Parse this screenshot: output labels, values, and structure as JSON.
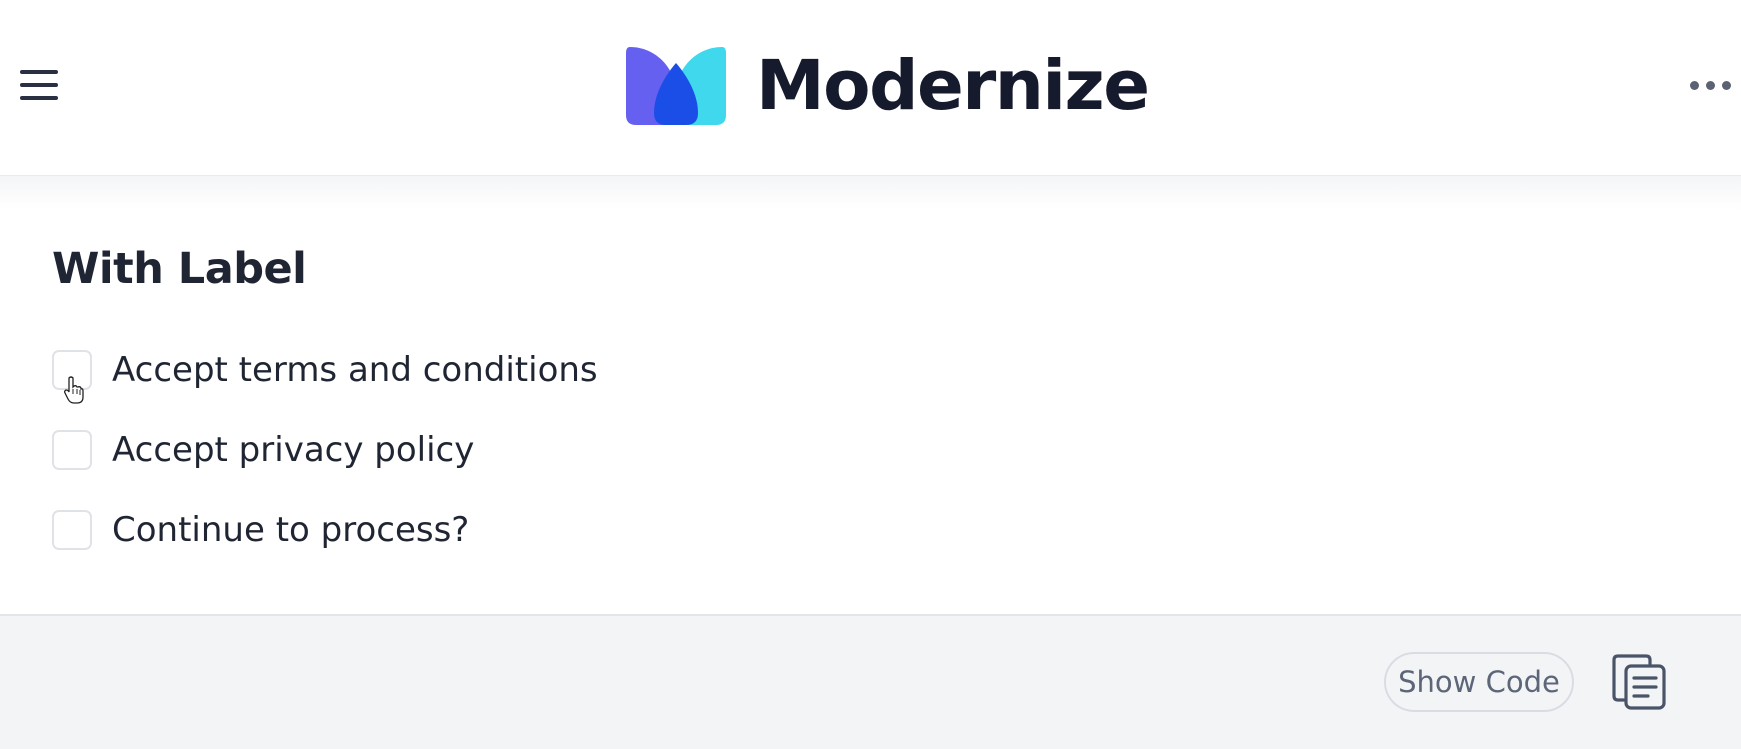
{
  "header": {
    "menu_icon": "hamburger-menu-icon",
    "brand_name": "Modernize",
    "brand_logo_icon": "modernize-logo-icon",
    "more_icon": "more-horizontal-icon",
    "colors": {
      "logo_purple": "#6560f0",
      "logo_cyan": "#3fd8ec",
      "logo_blue": "#1b4ee6",
      "brand_text": "#151a2d"
    }
  },
  "section": {
    "title": "With Label",
    "checkboxes": [
      {
        "label": "Accept terms and conditions",
        "checked": false
      },
      {
        "label": "Accept privacy policy",
        "checked": false
      },
      {
        "label": "Continue to process?",
        "checked": false
      }
    ]
  },
  "footer": {
    "show_code_label": "Show Code",
    "copy_icon": "copy-clipboard-icon"
  }
}
